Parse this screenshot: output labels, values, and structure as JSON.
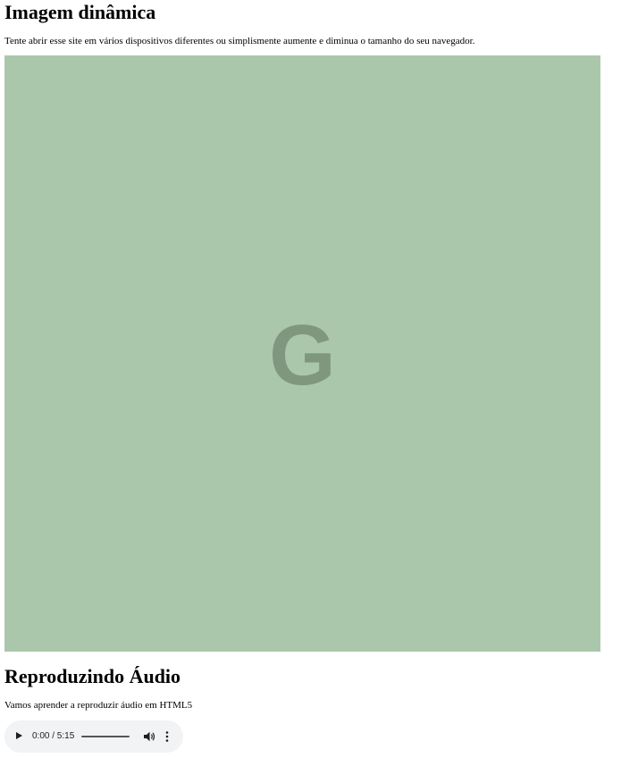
{
  "section_image": {
    "title": "Imagem dinâmica",
    "description": "Tente abrir esse site em vários dispositivos diferentes ou simplismente aumente e diminua o tamanho do seu navegador.",
    "image_letter": "G",
    "image_bg_color": "#abc7ab",
    "image_letter_color": "#7f977f"
  },
  "section_audio": {
    "title": "Reproduzindo Áudio",
    "description": "Vamos aprender a reproduzir áudio em HTML5",
    "player": {
      "time_display": "0:00 / 5:15",
      "current_time": "0:00",
      "duration": "5:15",
      "progress": 0,
      "play_icon": "play-icon",
      "volume_icon": "volume-icon",
      "menu_icon": "more-vert-icon",
      "background_color": "#f1f3f4"
    }
  }
}
